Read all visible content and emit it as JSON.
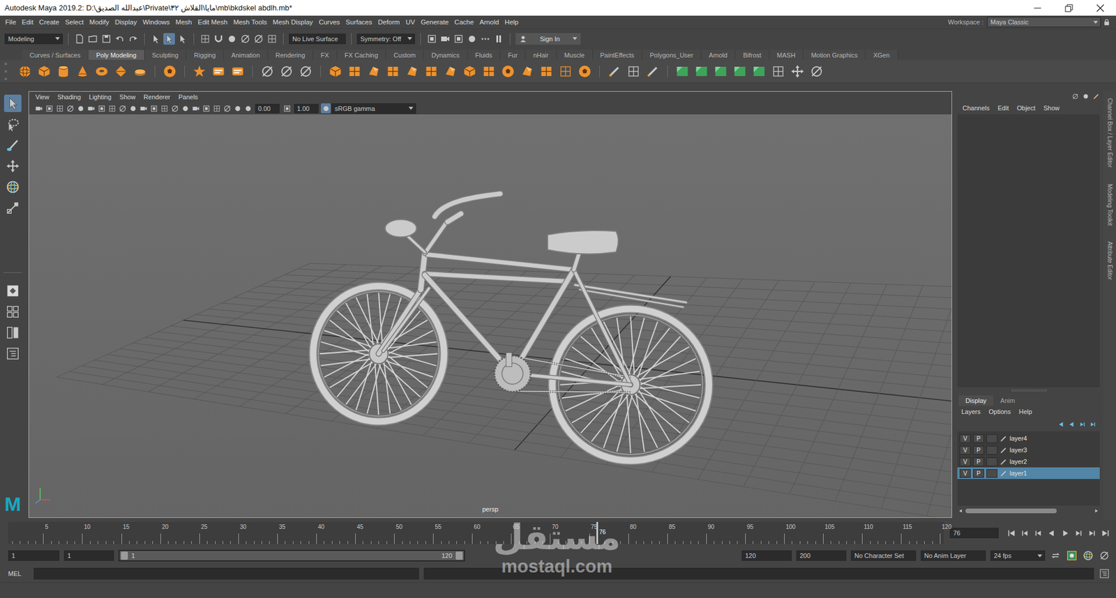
{
  "window": {
    "title": "Autodesk Maya 2019.2: D:\\عبدالله الصديق\\Private\\مايا\\القلاش ٣٢\\mb\\bkdskel abdlh.mb*"
  },
  "menu": [
    "File",
    "Edit",
    "Create",
    "Select",
    "Modify",
    "Display",
    "Windows",
    "Mesh",
    "Edit Mesh",
    "Mesh Tools",
    "Mesh Display",
    "Curves",
    "Surfaces",
    "Deform",
    "UV",
    "Generate",
    "Cache",
    "Arnold",
    "Help"
  ],
  "workspace": {
    "label": "Workspace :",
    "value": "Maya Classic"
  },
  "status_line": {
    "mode": "Modeling",
    "live_surface": "No Live Surface",
    "symmetry": "Symmetry: Off",
    "sign_in": "Sign In"
  },
  "shelf_tabs": [
    {
      "label": "Curves / Surfaces",
      "selected": false
    },
    {
      "label": "Poly Modeling",
      "selected": true
    },
    {
      "label": "Sculpting",
      "selected": false
    },
    {
      "label": "Rigging",
      "selected": false
    },
    {
      "label": "Animation",
      "selected": false
    },
    {
      "label": "Rendering",
      "selected": false
    },
    {
      "label": "FX",
      "selected": false
    },
    {
      "label": "FX Caching",
      "selected": false
    },
    {
      "label": "Custom",
      "selected": false
    },
    {
      "label": "Dynamics",
      "selected": false
    },
    {
      "label": "Fluids",
      "selected": false
    },
    {
      "label": "Fur",
      "selected": false
    },
    {
      "label": "nHair",
      "selected": false
    },
    {
      "label": "Muscle",
      "selected": false
    },
    {
      "label": "PaintEffects",
      "selected": false
    },
    {
      "label": "Polygons_User",
      "selected": false
    },
    {
      "label": "Arnold",
      "selected": false
    },
    {
      "label": "Bifrost",
      "selected": false
    },
    {
      "label": "MASH",
      "selected": false
    },
    {
      "label": "Motion Graphics",
      "selected": false
    },
    {
      "label": "XGen",
      "selected": false
    }
  ],
  "logo": "M",
  "panel_menu": [
    "View",
    "Shading",
    "Lighting",
    "Show",
    "Renderer",
    "Panels"
  ],
  "panel_toolbar": {
    "exposure": "0.00",
    "gamma": "1.00",
    "color_space": "sRGB gamma"
  },
  "viewport": {
    "camera": "persp"
  },
  "channel_box": {
    "menu": [
      "Channels",
      "Edit",
      "Object",
      "Show"
    ]
  },
  "layer_editor": {
    "tabs": [
      {
        "label": "Display",
        "selected": true
      },
      {
        "label": "Anim",
        "selected": false
      }
    ],
    "menu": [
      "Layers",
      "Options",
      "Help"
    ],
    "layers": [
      {
        "name": "layer4",
        "visible": true,
        "playback": true,
        "selected": false
      },
      {
        "name": "layer3",
        "visible": true,
        "playback": true,
        "selected": false
      },
      {
        "name": "layer2",
        "visible": true,
        "playback": true,
        "selected": false
      },
      {
        "name": "layer1",
        "visible": true,
        "playback": true,
        "selected": true
      }
    ],
    "visible_mark": "V",
    "playback_mark": "P"
  },
  "side_tabs": [
    "Channel Box / Layer Editor",
    "Modeling Toolkit",
    "Attribute Editor"
  ],
  "time_slider": {
    "ticks": [
      "5",
      "10",
      "15",
      "20",
      "25",
      "30",
      "35",
      "40",
      "45",
      "50",
      "55",
      "60",
      "65",
      "70",
      "75",
      "80",
      "85",
      "90",
      "95",
      "100",
      "105",
      "110",
      "115",
      "120"
    ],
    "current": "76",
    "current_field": "76"
  },
  "range": {
    "start": "1",
    "playback_start": "1",
    "slider_start": "1",
    "slider_end": "120",
    "playback_end": "120",
    "end": "200",
    "character_set": "No Character Set",
    "anim_layer": "No Anim Layer",
    "fps": "24 fps"
  },
  "command_line": {
    "language": "MEL"
  },
  "watermark": {
    "arabic": "مستقل",
    "latin": "mostaql.com"
  }
}
